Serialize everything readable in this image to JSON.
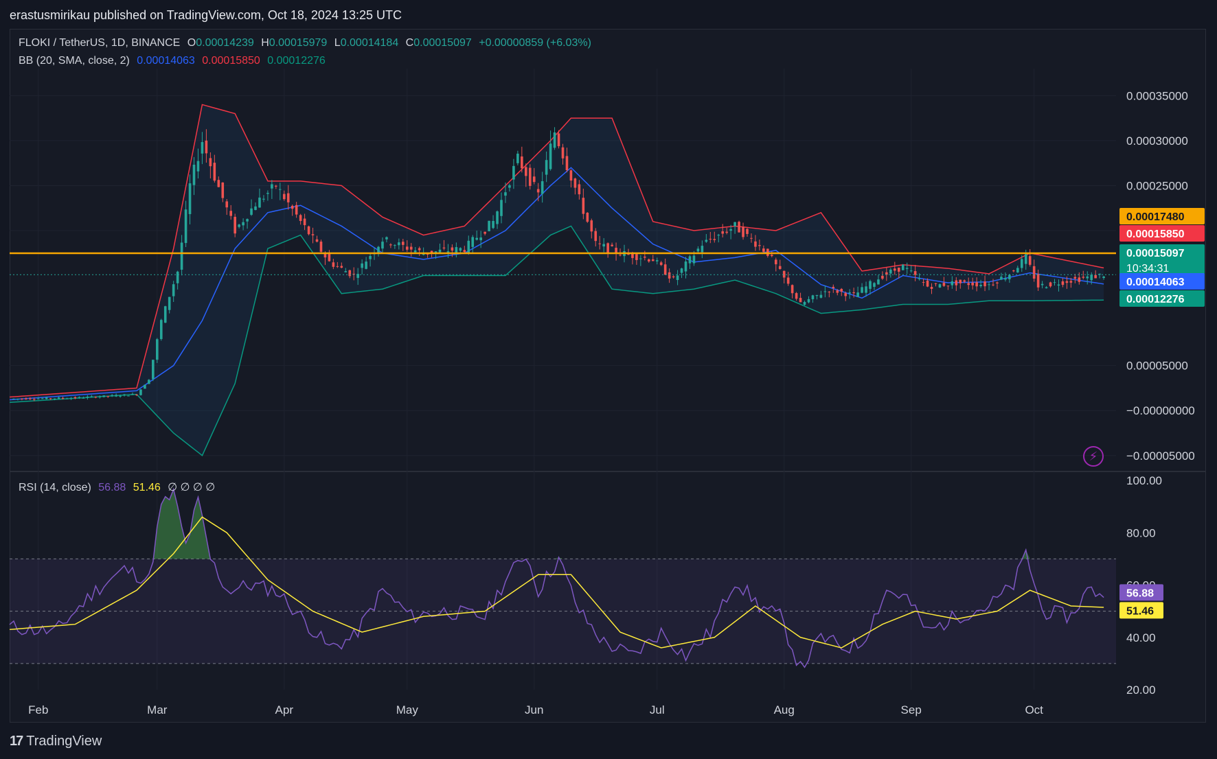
{
  "header": {
    "publisher": "erastusmirikau published on TradingView.com, Oct 18, 2024 13:25 UTC"
  },
  "legend": {
    "symbol": "FLOKI / TetherUS, 1D, BINANCE",
    "o_label": "O",
    "o_value": "0.00014239",
    "h_label": "H",
    "h_value": "0.00015979",
    "l_label": "L",
    "l_value": "0.00014184",
    "c_label": "C",
    "c_value": "0.00015097",
    "change": "+0.00000859 (+6.03%)",
    "bb_label": "BB (20, SMA, close, 2)",
    "bb_basis": "0.00014063",
    "bb_upper": "0.00015850",
    "bb_lower": "0.00012276"
  },
  "rsi_legend": {
    "label": "RSI (14, close)",
    "rsi": "56.88",
    "ma": "51.46",
    "extras": "∅ ∅ ∅ ∅"
  },
  "colors": {
    "bg": "#131722",
    "up": "#26a69a",
    "down": "#ef5350",
    "bb_basis": "#2962ff",
    "bb_upper": "#f23645",
    "bb_lower": "#089981",
    "hline": "#f7a600",
    "rsi": "#7e57c2",
    "rsi_ma": "#ffeb3b"
  },
  "price_tags": [
    {
      "value": "0.00017480",
      "color": "#f7a600",
      "text_color": "#131722"
    },
    {
      "value": "0.00015850",
      "color": "#f23645",
      "text_color": "#ffffff"
    },
    {
      "value": "0.00015097",
      "sub": "10:34:31",
      "color": "#089981",
      "text_color": "#ffffff"
    },
    {
      "value": "0.00014063",
      "color": "#2962ff",
      "text_color": "#ffffff"
    },
    {
      "value": "0.00012276",
      "color": "#089981",
      "text_color": "#ffffff"
    }
  ],
  "rsi_tags": [
    {
      "value": "56.88",
      "color": "#7e57c2",
      "text_color": "#ffffff"
    },
    {
      "value": "51.46",
      "color": "#ffeb3b",
      "text_color": "#131722"
    }
  ],
  "footer": {
    "brand": "TradingView"
  },
  "chart_data": [
    {
      "type": "candlestick",
      "title": "FLOKI / TetherUS, 1D, BINANCE",
      "y_ticks": [
        "0.00035000",
        "0.00030000",
        "0.00025000",
        "0.00020000",
        "0.00005000",
        "−0.00000000",
        "−0.00005000"
      ],
      "x_ticks": [
        "Feb",
        "Mar",
        "Apr",
        "May",
        "Jun",
        "Jul",
        "Aug",
        "Sep",
        "Oct"
      ],
      "ylim": [
        -7e-05,
        0.00038
      ],
      "horizontal_line": 0.0001748,
      "close_path": [
        [
          "2024-01-25",
          1.3e-05
        ],
        [
          "2024-02-10",
          1.4e-05
        ],
        [
          "2024-02-25",
          1.8e-05
        ],
        [
          "2024-02-28",
          3.5e-05
        ],
        [
          "2024-03-02",
          0.0001
        ],
        [
          "2024-03-06",
          0.000155
        ],
        [
          "2024-03-09",
          0.00025
        ],
        [
          "2024-03-12",
          0.0003
        ],
        [
          "2024-03-15",
          0.00026
        ],
        [
          "2024-03-20",
          0.0002
        ],
        [
          "2024-03-25",
          0.00023
        ],
        [
          "2024-03-30",
          0.00025
        ],
        [
          "2024-04-05",
          0.00021
        ],
        [
          "2024-04-12",
          0.000165
        ],
        [
          "2024-04-18",
          0.00015
        ],
        [
          "2024-04-25",
          0.00019
        ],
        [
          "2024-05-05",
          0.000175
        ],
        [
          "2024-05-15",
          0.00018
        ],
        [
          "2024-05-22",
          0.00021
        ],
        [
          "2024-05-28",
          0.00028
        ],
        [
          "2024-06-02",
          0.00024
        ],
        [
          "2024-06-06",
          0.00031
        ],
        [
          "2024-06-10",
          0.00026
        ],
        [
          "2024-06-16",
          0.000185
        ],
        [
          "2024-06-22",
          0.000175
        ],
        [
          "2024-06-30",
          0.000168
        ],
        [
          "2024-07-05",
          0.000145
        ],
        [
          "2024-07-12",
          0.000185
        ],
        [
          "2024-07-20",
          0.000205
        ],
        [
          "2024-07-28",
          0.000175
        ],
        [
          "2024-08-05",
          0.000118
        ],
        [
          "2024-08-12",
          0.000135
        ],
        [
          "2024-08-18",
          0.000128
        ],
        [
          "2024-08-25",
          0.00015
        ],
        [
          "2024-08-30",
          0.00016
        ],
        [
          "2024-09-05",
          0.000138
        ],
        [
          "2024-09-12",
          0.000142
        ],
        [
          "2024-09-20",
          0.00014
        ],
        [
          "2024-09-25",
          0.000152
        ],
        [
          "2024-09-29",
          0.00017
        ],
        [
          "2024-10-02",
          0.000138
        ],
        [
          "2024-10-10",
          0.000145
        ],
        [
          "2024-10-18",
          0.000151
        ]
      ],
      "bollinger": {
        "basis": [
          [
            "2024-01-25",
            1.2e-05
          ],
          [
            "2024-02-25",
            2.2e-05
          ],
          [
            "2024-03-05",
            5e-05
          ],
          [
            "2024-03-12",
            0.0001
          ],
          [
            "2024-03-20",
            0.00018
          ],
          [
            "2024-03-28",
            0.00022
          ],
          [
            "2024-04-05",
            0.000228
          ],
          [
            "2024-04-15",
            0.000205
          ],
          [
            "2024-04-25",
            0.000175
          ],
          [
            "2024-05-05",
            0.000168
          ],
          [
            "2024-05-15",
            0.000175
          ],
          [
            "2024-05-25",
            0.0002
          ],
          [
            "2024-06-05",
            0.00025
          ],
          [
            "2024-06-10",
            0.00027
          ],
          [
            "2024-06-20",
            0.000225
          ],
          [
            "2024-06-30",
            0.000185
          ],
          [
            "2024-07-10",
            0.000165
          ],
          [
            "2024-07-20",
            0.00017
          ],
          [
            "2024-07-30",
            0.000178
          ],
          [
            "2024-08-10",
            0.00014
          ],
          [
            "2024-08-20",
            0.000125
          ],
          [
            "2024-08-30",
            0.00015
          ],
          [
            "2024-09-10",
            0.000142
          ],
          [
            "2024-09-20",
            0.000143
          ],
          [
            "2024-09-30",
            0.000153
          ],
          [
            "2024-10-18",
            0.00014063
          ]
        ],
        "upper": [
          [
            "2024-01-25",
            1.5e-05
          ],
          [
            "2024-02-25",
            2.5e-05
          ],
          [
            "2024-03-05",
            0.00018
          ],
          [
            "2024-03-12",
            0.00034
          ],
          [
            "2024-03-20",
            0.00033
          ],
          [
            "2024-03-28",
            0.000255
          ],
          [
            "2024-04-05",
            0.000255
          ],
          [
            "2024-04-15",
            0.00025
          ],
          [
            "2024-04-25",
            0.000215
          ],
          [
            "2024-05-05",
            0.000195
          ],
          [
            "2024-05-15",
            0.000205
          ],
          [
            "2024-05-25",
            0.00025
          ],
          [
            "2024-06-05",
            0.0003
          ],
          [
            "2024-06-10",
            0.000325
          ],
          [
            "2024-06-20",
            0.000325
          ],
          [
            "2024-06-30",
            0.00021
          ],
          [
            "2024-07-10",
            0.0002
          ],
          [
            "2024-07-20",
            0.000205
          ],
          [
            "2024-07-30",
            0.0002
          ],
          [
            "2024-08-10",
            0.00022
          ],
          [
            "2024-08-20",
            0.000155
          ],
          [
            "2024-08-30",
            0.000162
          ],
          [
            "2024-09-10",
            0.000158
          ],
          [
            "2024-09-20",
            0.000152
          ],
          [
            "2024-09-30",
            0.000175
          ],
          [
            "2024-10-18",
            0.0001585
          ]
        ],
        "lower": [
          [
            "2024-01-25",
            9e-06
          ],
          [
            "2024-02-25",
            1.8e-05
          ],
          [
            "2024-03-05",
            -2.5e-05
          ],
          [
            "2024-03-12",
            -5e-05
          ],
          [
            "2024-03-20",
            3e-05
          ],
          [
            "2024-03-28",
            0.00018
          ],
          [
            "2024-04-05",
            0.000195
          ],
          [
            "2024-04-15",
            0.00013
          ],
          [
            "2024-04-25",
            0.000135
          ],
          [
            "2024-05-05",
            0.00015
          ],
          [
            "2024-05-15",
            0.00015
          ],
          [
            "2024-05-25",
            0.00015
          ],
          [
            "2024-06-05",
            0.000195
          ],
          [
            "2024-06-10",
            0.000205
          ],
          [
            "2024-06-20",
            0.000135
          ],
          [
            "2024-06-30",
            0.00013
          ],
          [
            "2024-07-10",
            0.000135
          ],
          [
            "2024-07-20",
            0.000145
          ],
          [
            "2024-07-30",
            0.00013
          ],
          [
            "2024-08-10",
            0.000108
          ],
          [
            "2024-08-20",
            0.000112
          ],
          [
            "2024-08-30",
            0.000118
          ],
          [
            "2024-09-10",
            0.000118
          ],
          [
            "2024-09-20",
            0.000122
          ],
          [
            "2024-09-30",
            0.000122
          ],
          [
            "2024-10-18",
            0.00012276
          ]
        ]
      }
    },
    {
      "type": "line",
      "title": "RSI (14, close)",
      "y_ticks": [
        "100.00",
        "80.00",
        "60.00",
        "40.00",
        "20.00"
      ],
      "ylim": [
        20,
        100
      ],
      "bands": [
        30,
        50,
        70
      ],
      "series": [
        {
          "name": "RSI",
          "values": [
            [
              "2024-01-25",
              44
            ],
            [
              "2024-02-05",
              42
            ],
            [
              "2024-02-15",
              58
            ],
            [
              "2024-02-22",
              66
            ],
            [
              "2024-02-28",
              62
            ],
            [
              "2024-03-02",
              90
            ],
            [
              "2024-03-05",
              95
            ],
            [
              "2024-03-08",
              75
            ],
            [
              "2024-03-11",
              92
            ],
            [
              "2024-03-14",
              70
            ],
            [
              "2024-03-18",
              58
            ],
            [
              "2024-03-24",
              60
            ],
            [
              "2024-03-30",
              58
            ],
            [
              "2024-04-05",
              48
            ],
            [
              "2024-04-12",
              36
            ],
            [
              "2024-04-18",
              40
            ],
            [
              "2024-04-25",
              58
            ],
            [
              "2024-05-02",
              48
            ],
            [
              "2024-05-10",
              50
            ],
            [
              "2024-05-20",
              48
            ],
            [
              "2024-05-25",
              62
            ],
            [
              "2024-05-30",
              72
            ],
            [
              "2024-06-02",
              58
            ],
            [
              "2024-06-07",
              70
            ],
            [
              "2024-06-12",
              50
            ],
            [
              "2024-06-18",
              38
            ],
            [
              "2024-06-25",
              33
            ],
            [
              "2024-07-02",
              42
            ],
            [
              "2024-07-08",
              33
            ],
            [
              "2024-07-14",
              42
            ],
            [
              "2024-07-20",
              62
            ],
            [
              "2024-07-26",
              52
            ],
            [
              "2024-07-31",
              48
            ],
            [
              "2024-08-05",
              28
            ],
            [
              "2024-08-10",
              40
            ],
            [
              "2024-08-16",
              36
            ],
            [
              "2024-08-20",
              38
            ],
            [
              "2024-08-26",
              58
            ],
            [
              "2024-08-31",
              55
            ],
            [
              "2024-09-05",
              42
            ],
            [
              "2024-09-12",
              48
            ],
            [
              "2024-09-20",
              52
            ],
            [
              "2024-09-26",
              60
            ],
            [
              "2024-09-29",
              72
            ],
            [
              "2024-10-03",
              50
            ],
            [
              "2024-10-10",
              48
            ],
            [
              "2024-10-14",
              58
            ],
            [
              "2024-10-18",
              56.88
            ]
          ]
        },
        {
          "name": "RSI-based MA",
          "values": [
            [
              "2024-01-25",
              43
            ],
            [
              "2024-02-10",
              45
            ],
            [
              "2024-02-25",
              58
            ],
            [
              "2024-03-05",
              72
            ],
            [
              "2024-03-12",
              86
            ],
            [
              "2024-03-18",
              80
            ],
            [
              "2024-03-28",
              62
            ],
            [
              "2024-04-08",
              50
            ],
            [
              "2024-04-20",
              42
            ],
            [
              "2024-05-05",
              48
            ],
            [
              "2024-05-20",
              50
            ],
            [
              "2024-06-02",
              64
            ],
            [
              "2024-06-10",
              64
            ],
            [
              "2024-06-22",
              42
            ],
            [
              "2024-07-02",
              36
            ],
            [
              "2024-07-15",
              40
            ],
            [
              "2024-07-25",
              52
            ],
            [
              "2024-08-05",
              40
            ],
            [
              "2024-08-15",
              36
            ],
            [
              "2024-08-25",
              45
            ],
            [
              "2024-09-02",
              50
            ],
            [
              "2024-09-12",
              47
            ],
            [
              "2024-09-22",
              50
            ],
            [
              "2024-09-30",
              58
            ],
            [
              "2024-10-10",
              52
            ],
            [
              "2024-10-18",
              51.46
            ]
          ]
        }
      ]
    }
  ]
}
